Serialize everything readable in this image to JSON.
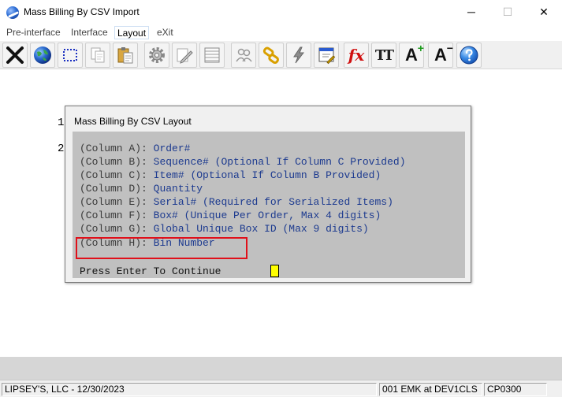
{
  "window": {
    "title": "Mass Billing By CSV Import",
    "minimize_glyph": "─",
    "maximize_glyph": "☐",
    "close_glyph": "✕"
  },
  "menu": {
    "items": [
      {
        "label": "Pre-interface"
      },
      {
        "label": "Interface"
      },
      {
        "label": "Layout"
      },
      {
        "label": "eXit"
      }
    ]
  },
  "toolbar": {
    "icons": [
      "close-x-icon",
      "globe-icon",
      "select-rect-icon",
      "copy-pages-icon",
      "clipboard-paste-icon",
      "gear-icon",
      "edit-pencil-icon",
      "grid-table-icon",
      "users-icon",
      "chain-link-icon",
      "lightning-icon",
      "window-edit-icon",
      "function-fx-icon",
      "text-size-icon",
      "font-increase-icon",
      "font-decrease-icon",
      "help-info-icon"
    ],
    "fx_label": "fx",
    "tt_label": "TT",
    "font_increase_label": "A",
    "font_increase_sup": "+",
    "font_decrease_label": "A",
    "font_decrease_sup": "−"
  },
  "background": {
    "line_numbers": [
      "1",
      "2"
    ]
  },
  "dialog": {
    "title": "Mass Billing By CSV Layout",
    "lines": [
      {
        "label": "(Column A):",
        "value": "Order#"
      },
      {
        "label": "(Column B):",
        "value": "Sequence# (Optional If Column C Provided)"
      },
      {
        "label": "(Column C):",
        "value": "Item# (Optional If Column B Provided)"
      },
      {
        "label": "(Column D):",
        "value": "Quantity"
      },
      {
        "label": "(Column E):",
        "value": "Serial# (Required for Serialized Items)"
      },
      {
        "label": "(Column F):",
        "value": "Box# (Unique Per Order, Max 4 digits)"
      },
      {
        "label": "(Column G):",
        "value": "Global Unique Box ID (Max 9 digits)"
      },
      {
        "label": "(Column H):",
        "value": "Bin Number"
      }
    ],
    "prompt": "Press Enter To Continue",
    "highlight_color": "#e0101a"
  },
  "statusbar": {
    "company": "LIPSEY'S, LLC - 12/30/2023",
    "session": "001 EMK at DEV1CLS",
    "program": "CP0300"
  }
}
